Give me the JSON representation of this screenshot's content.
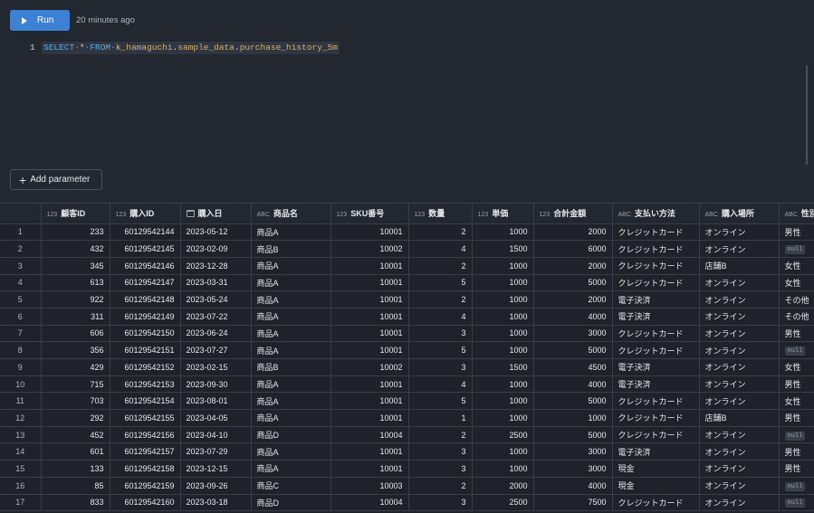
{
  "toolbar": {
    "run_label": "Run",
    "last_run": "20 minutes ago"
  },
  "editor": {
    "line_number": "1",
    "query": {
      "select": "SELECT",
      "star": "*",
      "from": "FROM",
      "schema": "k_hamaguchi",
      "dataset": "sample_data",
      "table": "purchase_history_5m"
    },
    "add_parameter_label": "Add parameter"
  },
  "results": {
    "columns": [
      {
        "label": "顧客ID",
        "type": "number"
      },
      {
        "label": "購入ID",
        "type": "number"
      },
      {
        "label": "購入日",
        "type": "date"
      },
      {
        "label": "商品名",
        "type": "string"
      },
      {
        "label": "SKU番号",
        "type": "number"
      },
      {
        "label": "数量",
        "type": "number"
      },
      {
        "label": "単価",
        "type": "number"
      },
      {
        "label": "合計金額",
        "type": "number"
      },
      {
        "label": "支払い方法",
        "type": "string"
      },
      {
        "label": "購入場所",
        "type": "string"
      },
      {
        "label": "性別",
        "type": "string"
      }
    ],
    "rows": [
      [
        "1",
        "233",
        "60129542144",
        "2023-05-12",
        "商品A",
        "10001",
        "2",
        "1000",
        "2000",
        "クレジットカード",
        "オンライン",
        "男性"
      ],
      [
        "2",
        "432",
        "60129542145",
        "2023-02-09",
        "商品B",
        "10002",
        "4",
        "1500",
        "6000",
        "クレジットカード",
        "オンライン",
        "null"
      ],
      [
        "3",
        "345",
        "60129542146",
        "2023-12-28",
        "商品A",
        "10001",
        "2",
        "1000",
        "2000",
        "クレジットカード",
        "店舗B",
        "女性"
      ],
      [
        "4",
        "613",
        "60129542147",
        "2023-03-31",
        "商品A",
        "10001",
        "5",
        "1000",
        "5000",
        "クレジットカード",
        "オンライン",
        "女性"
      ],
      [
        "5",
        "922",
        "60129542148",
        "2023-05-24",
        "商品A",
        "10001",
        "2",
        "1000",
        "2000",
        "電子決済",
        "オンライン",
        "その他"
      ],
      [
        "6",
        "311",
        "60129542149",
        "2023-07-22",
        "商品A",
        "10001",
        "4",
        "1000",
        "4000",
        "電子決済",
        "オンライン",
        "その他"
      ],
      [
        "7",
        "606",
        "60129542150",
        "2023-06-24",
        "商品A",
        "10001",
        "3",
        "1000",
        "3000",
        "クレジットカード",
        "オンライン",
        "男性"
      ],
      [
        "8",
        "356",
        "60129542151",
        "2023-07-27",
        "商品A",
        "10001",
        "5",
        "1000",
        "5000",
        "クレジットカード",
        "オンライン",
        "null"
      ],
      [
        "9",
        "429",
        "60129542152",
        "2023-02-15",
        "商品B",
        "10002",
        "3",
        "1500",
        "4500",
        "電子決済",
        "オンライン",
        "女性"
      ],
      [
        "10",
        "715",
        "60129542153",
        "2023-09-30",
        "商品A",
        "10001",
        "4",
        "1000",
        "4000",
        "電子決済",
        "オンライン",
        "男性"
      ],
      [
        "11",
        "703",
        "60129542154",
        "2023-08-01",
        "商品A",
        "10001",
        "5",
        "1000",
        "5000",
        "クレジットカード",
        "オンライン",
        "女性"
      ],
      [
        "12",
        "292",
        "60129542155",
        "2023-04-05",
        "商品A",
        "10001",
        "1",
        "1000",
        "1000",
        "クレジットカード",
        "店舗B",
        "男性"
      ],
      [
        "13",
        "452",
        "60129542156",
        "2023-04-10",
        "商品D",
        "10004",
        "2",
        "2500",
        "5000",
        "クレジットカード",
        "オンライン",
        "null"
      ],
      [
        "14",
        "601",
        "60129542157",
        "2023-07-29",
        "商品A",
        "10001",
        "3",
        "1000",
        "3000",
        "電子決済",
        "オンライン",
        "男性"
      ],
      [
        "15",
        "133",
        "60129542158",
        "2023-12-15",
        "商品A",
        "10001",
        "3",
        "1000",
        "3000",
        "現金",
        "オンライン",
        "男性"
      ],
      [
        "16",
        "85",
        "60129542159",
        "2023-09-26",
        "商品C",
        "10003",
        "2",
        "2000",
        "4000",
        "現金",
        "オンライン",
        "null"
      ],
      [
        "17",
        "833",
        "60129542160",
        "2023-03-18",
        "商品D",
        "10004",
        "3",
        "2500",
        "7500",
        "クレジットカード",
        "オンライン",
        "null"
      ]
    ]
  }
}
